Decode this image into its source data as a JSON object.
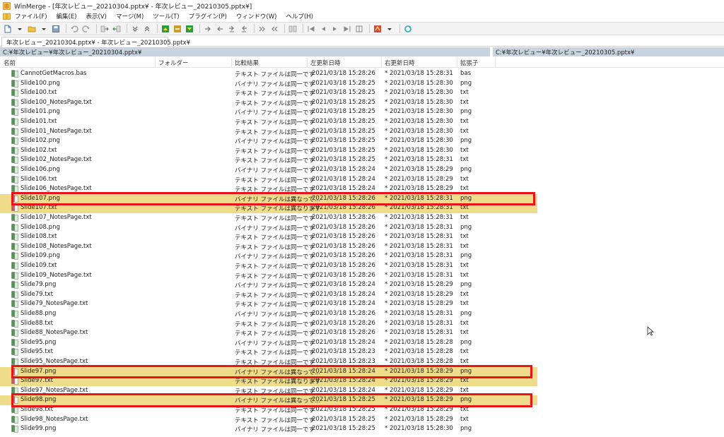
{
  "window": {
    "title": "WinMerge - [年次レビュー_20210304.pptx¥ - 年次レビュー_20210305.pptx¥]"
  },
  "menu": [
    "ファイル(F)",
    "編集(E)",
    "表示(V)",
    "マージ(M)",
    "ツール(T)",
    "プラグイン(P)",
    "ウィンドウ(W)",
    "ヘルプ(H)"
  ],
  "tab": {
    "label": "年次レビュー_20210304.pptx¥ - 年次レビュー_20210305.pptx¥"
  },
  "paths": {
    "left": "C:¥年次レビュー¥年次レビュー_20210304.pptx¥",
    "right": "C:¥年次レビュー¥年次レビュー_20210305.pptx¥"
  },
  "columns": {
    "name": "名前",
    "folder": "フォルダー",
    "result": "比較結果",
    "left_date": "左更新日時",
    "right_date": "右更新日時",
    "ext": "拡張子"
  },
  "colors": {
    "diff_row": "#efdc8a",
    "highlight": "#e8141b",
    "path_bar": "#c8d4e0"
  },
  "rows": [
    {
      "name": "CannotGetMacros.bas",
      "result": "テキスト ファイルは同一です",
      "left": "2021/03/18 15:28:26",
      "right": "* 2021/03/18 15:28:31",
      "ext": "bas",
      "diff": false
    },
    {
      "name": "Slide100.png",
      "result": "バイナリ ファイルは同一です",
      "left": "2021/03/18 15:28:25",
      "right": "* 2021/03/18 15:28:30",
      "ext": "png",
      "diff": false
    },
    {
      "name": "Slide100.txt",
      "result": "テキスト ファイルは同一です",
      "left": "2021/03/18 15:28:25",
      "right": "* 2021/03/18 15:28:30",
      "ext": "txt",
      "diff": false
    },
    {
      "name": "Slide100_NotesPage.txt",
      "result": "テキスト ファイルは同一です",
      "left": "2021/03/18 15:28:25",
      "right": "* 2021/03/18 15:28:30",
      "ext": "txt",
      "diff": false
    },
    {
      "name": "Slide101.png",
      "result": "バイナリ ファイルは同一です",
      "left": "2021/03/18 15:28:25",
      "right": "* 2021/03/18 15:28:30",
      "ext": "png",
      "diff": false
    },
    {
      "name": "Slide101.txt",
      "result": "テキスト ファイルは同一です",
      "left": "2021/03/18 15:28:25",
      "right": "* 2021/03/18 15:28:30",
      "ext": "txt",
      "diff": false
    },
    {
      "name": "Slide101_NotesPage.txt",
      "result": "テキスト ファイルは同一です",
      "left": "2021/03/18 15:28:25",
      "right": "* 2021/03/18 15:28:30",
      "ext": "txt",
      "diff": false
    },
    {
      "name": "Slide102.png",
      "result": "バイナリ ファイルは同一です",
      "left": "2021/03/18 15:28:25",
      "right": "* 2021/03/18 15:28:30",
      "ext": "png",
      "diff": false
    },
    {
      "name": "Slide102.txt",
      "result": "テキスト ファイルは同一です",
      "left": "2021/03/18 15:28:25",
      "right": "* 2021/03/18 15:28:30",
      "ext": "txt",
      "diff": false
    },
    {
      "name": "Slide102_NotesPage.txt",
      "result": "テキスト ファイルは同一です",
      "left": "2021/03/18 15:28:25",
      "right": "* 2021/03/18 15:28:31",
      "ext": "txt",
      "diff": false
    },
    {
      "name": "Slide106.png",
      "result": "バイナリ ファイルは同一です",
      "left": "2021/03/18 15:28:24",
      "right": "* 2021/03/18 15:28:29",
      "ext": "png",
      "diff": false
    },
    {
      "name": "Slide106.txt",
      "result": "テキスト ファイルは同一です",
      "left": "2021/03/18 15:28:24",
      "right": "* 2021/03/18 15:28:29",
      "ext": "txt",
      "diff": false
    },
    {
      "name": "Slide106_NotesPage.txt",
      "result": "テキスト ファイルは同一です",
      "left": "2021/03/18 15:28:24",
      "right": "* 2021/03/18 15:28:29",
      "ext": "txt",
      "diff": false
    },
    {
      "name": "Slide107.png",
      "result": "バイナリ ファイルは異なって...",
      "left": "2021/03/18 15:28:26",
      "right": "* 2021/03/18 15:28:31",
      "ext": "png",
      "diff": true
    },
    {
      "name": "Slide107.txt",
      "result": "テキスト ファイルは異なります",
      "left": "2021/03/18 15:28:26",
      "right": "* 2021/03/18 15:28:31",
      "ext": "txt",
      "diff": true
    },
    {
      "name": "Slide107_NotesPage.txt",
      "result": "テキスト ファイルは同一です",
      "left": "2021/03/18 15:28:26",
      "right": "* 2021/03/18 15:28:31",
      "ext": "txt",
      "diff": false
    },
    {
      "name": "Slide108.png",
      "result": "バイナリ ファイルは同一です",
      "left": "2021/03/18 15:28:26",
      "right": "* 2021/03/18 15:28:31",
      "ext": "png",
      "diff": false
    },
    {
      "name": "Slide108.txt",
      "result": "テキスト ファイルは同一です",
      "left": "2021/03/18 15:28:26",
      "right": "* 2021/03/18 15:28:31",
      "ext": "txt",
      "diff": false
    },
    {
      "name": "Slide108_NotesPage.txt",
      "result": "テキスト ファイルは同一です",
      "left": "2021/03/18 15:28:26",
      "right": "* 2021/03/18 15:28:31",
      "ext": "txt",
      "diff": false
    },
    {
      "name": "Slide109.png",
      "result": "バイナリ ファイルは同一です",
      "left": "2021/03/18 15:28:26",
      "right": "* 2021/03/18 15:28:31",
      "ext": "png",
      "diff": false
    },
    {
      "name": "Slide109.txt",
      "result": "テキスト ファイルは同一です",
      "left": "2021/03/18 15:28:26",
      "right": "* 2021/03/18 15:28:31",
      "ext": "txt",
      "diff": false
    },
    {
      "name": "Slide109_NotesPage.txt",
      "result": "テキスト ファイルは同一です",
      "left": "2021/03/18 15:28:26",
      "right": "* 2021/03/18 15:28:31",
      "ext": "txt",
      "diff": false
    },
    {
      "name": "Slide79.png",
      "result": "バイナリ ファイルは同一です",
      "left": "2021/03/18 15:28:24",
      "right": "* 2021/03/18 15:28:29",
      "ext": "png",
      "diff": false
    },
    {
      "name": "Slide79.txt",
      "result": "テキスト ファイルは同一です",
      "left": "2021/03/18 15:28:24",
      "right": "* 2021/03/18 15:28:29",
      "ext": "txt",
      "diff": false
    },
    {
      "name": "Slide79_NotesPage.txt",
      "result": "テキスト ファイルは同一です",
      "left": "2021/03/18 15:28:24",
      "right": "* 2021/03/18 15:28:29",
      "ext": "txt",
      "diff": false
    },
    {
      "name": "Slide88.png",
      "result": "バイナリ ファイルは同一です",
      "left": "2021/03/18 15:28:26",
      "right": "* 2021/03/18 15:28:31",
      "ext": "png",
      "diff": false
    },
    {
      "name": "Slide88.txt",
      "result": "テキスト ファイルは同一です",
      "left": "2021/03/18 15:28:26",
      "right": "* 2021/03/18 15:28:31",
      "ext": "txt",
      "diff": false
    },
    {
      "name": "Slide88_NotesPage.txt",
      "result": "テキスト ファイルは同一です",
      "left": "2021/03/18 15:28:26",
      "right": "* 2021/03/18 15:28:31",
      "ext": "txt",
      "diff": false
    },
    {
      "name": "Slide95.png",
      "result": "バイナリ ファイルは同一です",
      "left": "2021/03/18 15:28:24",
      "right": "* 2021/03/18 15:28:28",
      "ext": "png",
      "diff": false
    },
    {
      "name": "Slide95.txt",
      "result": "テキスト ファイルは同一です",
      "left": "2021/03/18 15:28:23",
      "right": "* 2021/03/18 15:28:28",
      "ext": "txt",
      "diff": false
    },
    {
      "name": "Slide95_NotesPage.txt",
      "result": "テキスト ファイルは同一です",
      "left": "2021/03/18 15:28:23",
      "right": "* 2021/03/18 15:28:28",
      "ext": "txt",
      "diff": false
    },
    {
      "name": "Slide97.png",
      "result": "バイナリ ファイルは異なって...",
      "left": "2021/03/18 15:28:24",
      "right": "* 2021/03/18 15:28:29",
      "ext": "png",
      "diff": true
    },
    {
      "name": "Slide97.txt",
      "result": "テキスト ファイルは異なります",
      "left": "2021/03/18 15:28:24",
      "right": "* 2021/03/18 15:28:29",
      "ext": "txt",
      "diff": true
    },
    {
      "name": "Slide97_NotesPage.txt",
      "result": "テキスト ファイルは同一です",
      "left": "2021/03/18 15:28:24",
      "right": "* 2021/03/18 15:28:29",
      "ext": "txt",
      "diff": false
    },
    {
      "name": "Slide98.png",
      "result": "バイナリ ファイルは異なって...",
      "left": "2021/03/18 15:28:25",
      "right": "* 2021/03/18 15:28:29",
      "ext": "png",
      "diff": true
    },
    {
      "name": "Slide98.txt",
      "result": "テキスト ファイルは同一です",
      "left": "2021/03/18 15:28:25",
      "right": "* 2021/03/18 15:28:29",
      "ext": "txt",
      "diff": false
    },
    {
      "name": "Slide98_NotesPage.txt",
      "result": "テキスト ファイルは同一です",
      "left": "2021/03/18 15:28:25",
      "right": "* 2021/03/18 15:28:29",
      "ext": "txt",
      "diff": false
    },
    {
      "name": "Slide99.png",
      "result": "バイナリ ファイルは同一です",
      "left": "2021/03/18 15:28:25",
      "right": "* 2021/03/18 15:28:30",
      "ext": "png",
      "diff": false
    }
  ]
}
